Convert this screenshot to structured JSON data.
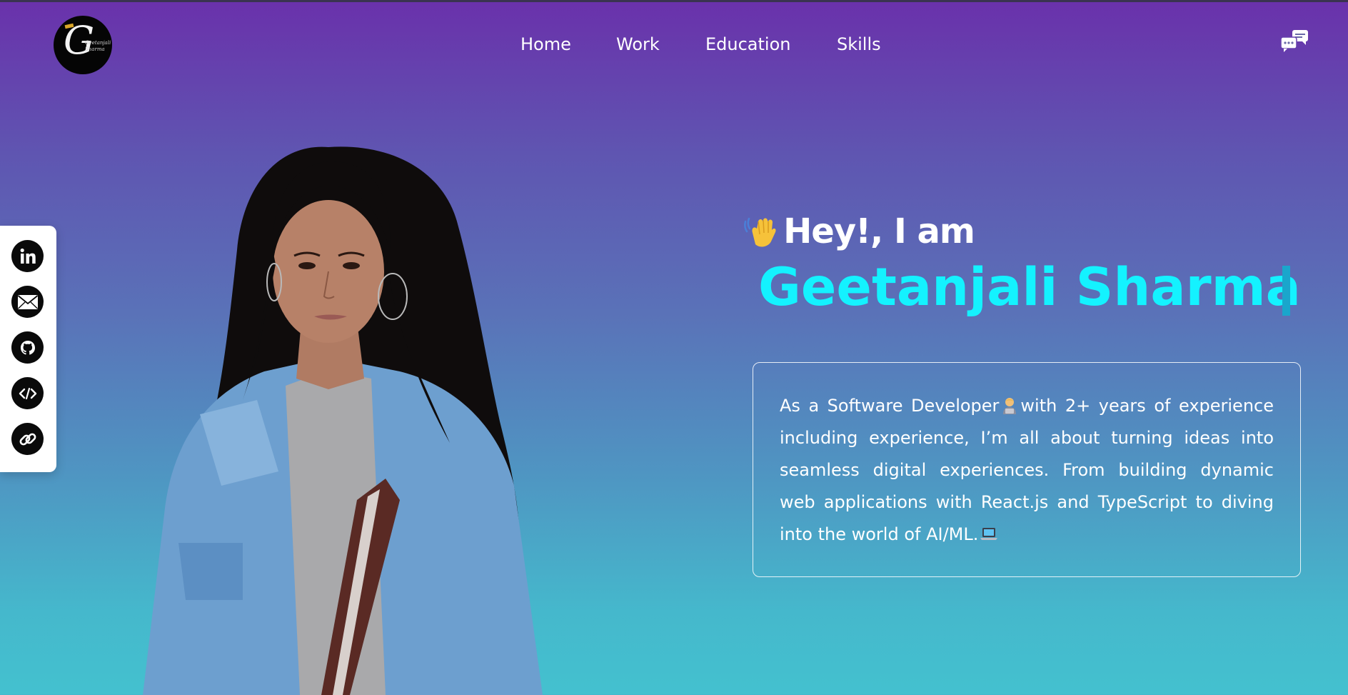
{
  "header": {
    "logo_letter": "G",
    "logo_script": "Geetanjali Sharma",
    "nav": [
      {
        "label": "Home"
      },
      {
        "label": "Work"
      },
      {
        "label": "Education"
      },
      {
        "label": "Skills"
      }
    ],
    "chat_icon": "chat-bubbles-icon"
  },
  "social": {
    "items": [
      {
        "icon": "linkedin-icon"
      },
      {
        "icon": "mail-icon"
      },
      {
        "icon": "github-icon"
      },
      {
        "icon": "code-icon"
      },
      {
        "icon": "link-icon"
      }
    ]
  },
  "hero": {
    "greeting": "Hey!, I am",
    "greeting_icon": "waving-hand-icon",
    "name": "Geetanjali Sharma",
    "bio_part1": "As a Software Developer",
    "bio_part2": "with 2+ years of experience including experience, I’m all about turning ideas into seamless digital experiences. From building dynamic web applications with React.js and TypeScript to diving into the world of AI/ML.",
    "bio_icon1": "technologist-icon",
    "bio_icon2": "laptop-icon"
  },
  "colors": {
    "gradient_top": "#6a31ab",
    "gradient_bottom": "#44c1cf",
    "name_accent": "#14f2ff"
  }
}
